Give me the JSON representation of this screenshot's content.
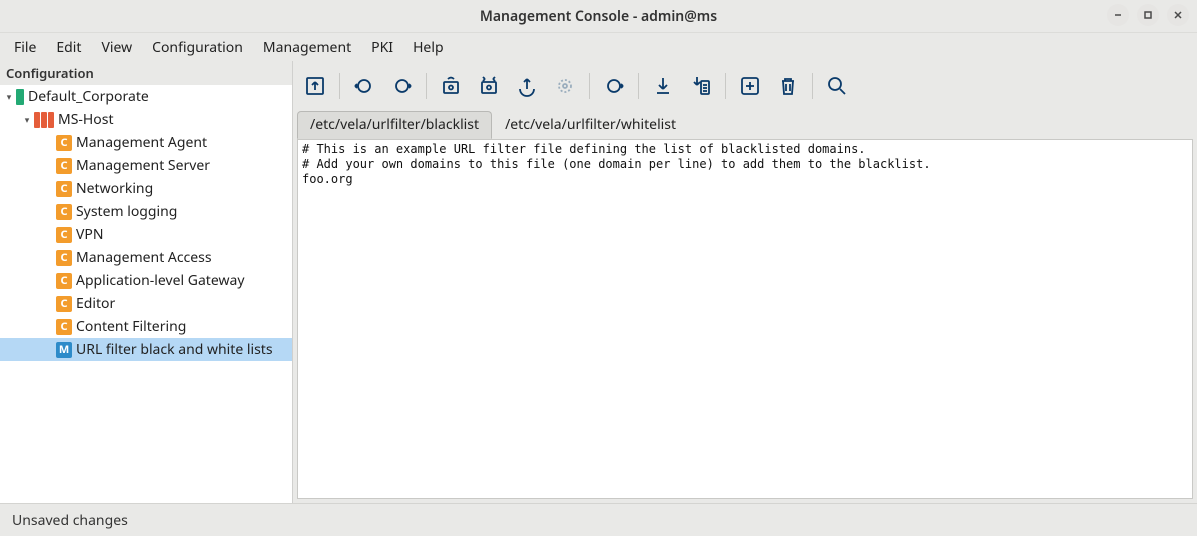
{
  "title": "Management Console - admin@ms",
  "menubar": [
    "File",
    "Edit",
    "View",
    "Configuration",
    "Management",
    "PKI",
    "Help"
  ],
  "sidebar": {
    "header": "Configuration",
    "site": "Default_Corporate",
    "host": "MS-Host",
    "components": [
      {
        "label": "Management Agent",
        "type": "C"
      },
      {
        "label": "Management Server",
        "type": "C"
      },
      {
        "label": "Networking",
        "type": "C"
      },
      {
        "label": "System logging",
        "type": "C"
      },
      {
        "label": "VPN",
        "type": "C"
      },
      {
        "label": "Management Access",
        "type": "C"
      },
      {
        "label": "Application-level Gateway",
        "type": "C"
      },
      {
        "label": "Editor",
        "type": "C"
      },
      {
        "label": "Content Filtering",
        "type": "C"
      },
      {
        "label": "URL filter black and white lists",
        "type": "M",
        "selected": true
      }
    ]
  },
  "tabs": [
    {
      "label": "/etc/vela/urlfilter/blacklist",
      "active": true
    },
    {
      "label": "/etc/vela/urlfilter/whitelist",
      "active": false
    }
  ],
  "editor": "# This is an example URL filter file defining the list of blacklisted domains.\n# Add your own domains to this file (one domain per line) to add them to the blacklist.\nfoo.org",
  "status": "Unsaved changes"
}
